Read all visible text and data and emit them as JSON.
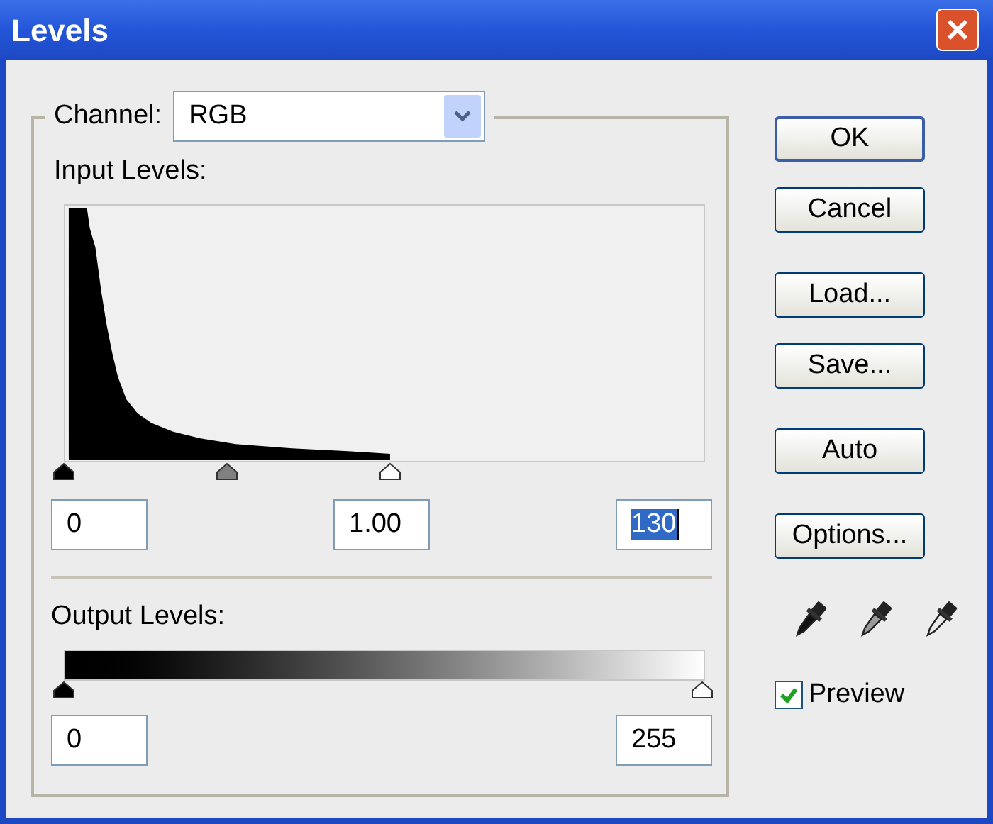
{
  "window": {
    "title": "Levels"
  },
  "channel": {
    "label": "Channel:",
    "value": "RGB"
  },
  "input_levels": {
    "label": "Input Levels:",
    "sliders": [
      {
        "kind": "black",
        "level": 0
      },
      {
        "kind": "gray",
        "level": 0.255
      },
      {
        "kind": "white",
        "level": 0.51
      }
    ],
    "fields": [
      {
        "value": "0",
        "selected": false
      },
      {
        "value": "1.00",
        "selected": false
      },
      {
        "value": "130",
        "selected": true
      }
    ]
  },
  "output_levels": {
    "label": "Output Levels:",
    "sliders": [
      {
        "kind": "black",
        "level": 0
      },
      {
        "kind": "white",
        "level": 1
      }
    ],
    "fields": [
      {
        "value": "0",
        "selected": false
      },
      {
        "value": "255",
        "selected": false
      }
    ]
  },
  "buttons": [
    {
      "label": "OK",
      "default": true
    },
    {
      "label": "Cancel",
      "default": false
    },
    {
      "label": "Load...",
      "default": false
    },
    {
      "label": "Save...",
      "default": false
    },
    {
      "label": "Auto",
      "default": false
    },
    {
      "label": "Options...",
      "default": false
    }
  ],
  "eyedroppers": [
    {
      "kind": "black"
    },
    {
      "kind": "gray"
    },
    {
      "kind": "white"
    }
  ],
  "preview": {
    "label": "Preview",
    "checked": true
  }
}
